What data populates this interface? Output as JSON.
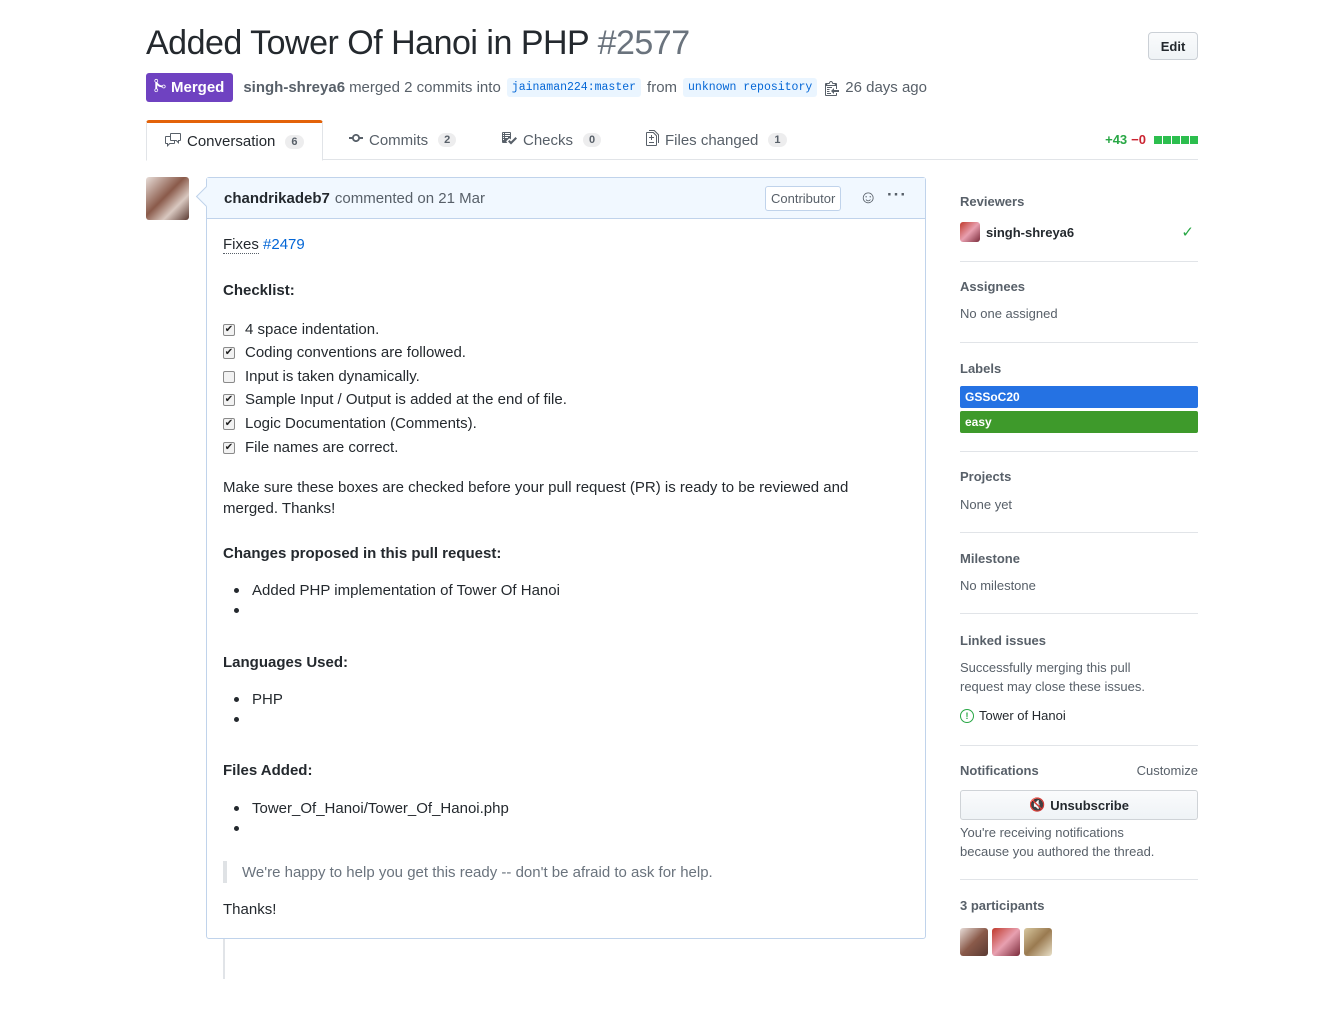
{
  "pr": {
    "title": "Added Tower Of Hanoi in PHP",
    "number": "#2577",
    "edit_label": "Edit",
    "status": "Merged",
    "merged_by": "singh-shreya6",
    "merged_text": "merged 2 commits into",
    "base_branch": "jainaman224:master",
    "from_text": "from",
    "head_branch": "unknown repository",
    "time_ago": "26 days ago"
  },
  "tabs": [
    {
      "label": "Conversation",
      "count": "6",
      "icon": "comment-discussion-icon"
    },
    {
      "label": "Commits",
      "count": "2",
      "icon": "git-commit-icon"
    },
    {
      "label": "Checks",
      "count": "0",
      "icon": "checklist-icon"
    },
    {
      "label": "Files changed",
      "count": "1",
      "icon": "file-diff-icon"
    }
  ],
  "diffstat": {
    "additions": "+43",
    "deletions": "−0"
  },
  "comment": {
    "author": "chandrikadeb7",
    "action": "commented on 21 Mar",
    "role_badge": "Contributor",
    "fixes_word": "Fixes",
    "fixes_issue": "#2479",
    "checklist_heading": "Checklist:",
    "checklist": [
      {
        "text": "4 space indentation.",
        "checked": true
      },
      {
        "text": "Coding conventions are followed.",
        "checked": true
      },
      {
        "text": "Input is taken dynamically.",
        "checked": false
      },
      {
        "text": "Sample Input / Output is added at the end of file.",
        "checked": true
      },
      {
        "text": "Logic Documentation (Comments).",
        "checked": true
      },
      {
        "text": "File names are correct.",
        "checked": true
      }
    ],
    "reminder": "Make sure these boxes are checked before your pull request (PR) is ready to be reviewed and merged. Thanks!",
    "changes_heading": "Changes proposed in this pull request:",
    "changes": [
      "Added PHP implementation of Tower Of Hanoi",
      ""
    ],
    "languages_heading": "Languages Used:",
    "languages": [
      "PHP",
      ""
    ],
    "files_heading": "Files Added:",
    "files": [
      "Tower_Of_Hanoi/Tower_Of_Hanoi.php",
      ""
    ],
    "quote": "We're happy to help you get this ready -- don't be afraid to ask for help.",
    "closing": "Thanks!"
  },
  "sidebar": {
    "reviewers_title": "Reviewers",
    "reviewer": "singh-shreya6",
    "assignees_title": "Assignees",
    "assignees_text": "No one assigned",
    "labels_title": "Labels",
    "labels": [
      {
        "name": "GSSoC20",
        "color": "#2572e3"
      },
      {
        "name": "easy",
        "color": "#3e9a2b"
      }
    ],
    "projects_title": "Projects",
    "projects_text": "None yet",
    "milestone_title": "Milestone",
    "milestone_text": "No milestone",
    "linked_title": "Linked issues",
    "linked_text_1": "Successfully merging this pull",
    "linked_text_2": "request may close these issues.",
    "linked_issue": "Tower of Hanoi",
    "notifications_title": "Notifications",
    "customize": "Customize",
    "unsubscribe": "Unsubscribe",
    "notif_text_1": "You're receiving notifications",
    "notif_text_2": "because you authored the thread.",
    "participants_title": "3 participants"
  },
  "colors": {
    "merged": "#6f42c1",
    "link": "#0366d6",
    "added": "#28a745",
    "deleted": "#cb2431",
    "tab_accent": "#e36209"
  }
}
